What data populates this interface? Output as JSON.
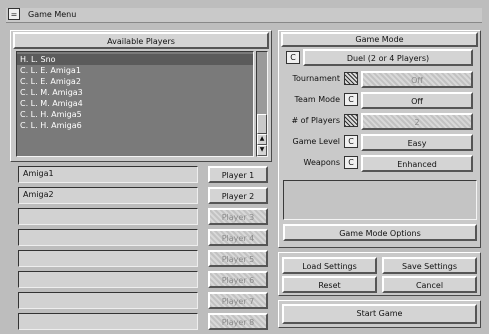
{
  "window": {
    "title": "Game Menu",
    "menu_glyph": "="
  },
  "players": {
    "header": "Available Players",
    "list": [
      "H. L. Sno",
      "C. L. E. Amiga1",
      "C. L. E. Amiga2",
      "C. L. M. Amiga3",
      "C. L. M. Amiga4",
      "C. L. H. Amiga5",
      "C. L. H. Amiga6"
    ],
    "scroll_up": "▲",
    "scroll_down": "▼",
    "slots": [
      {
        "value": "Amiga1",
        "button": "Player 1",
        "enabled": true
      },
      {
        "value": "Amiga2",
        "button": "Player 2",
        "enabled": true
      },
      {
        "value": "",
        "button": "Player 3",
        "enabled": false
      },
      {
        "value": "",
        "button": "Player 4",
        "enabled": false
      },
      {
        "value": "",
        "button": "Player 5",
        "enabled": false
      },
      {
        "value": "",
        "button": "Player 6",
        "enabled": false
      },
      {
        "value": "",
        "button": "Player 7",
        "enabled": false
      },
      {
        "value": "",
        "button": "Player 8",
        "enabled": false
      }
    ]
  },
  "game_mode": {
    "header": "Game Mode",
    "cycle_glyph": "C",
    "mode_value": "Duel (2 or 4 Players)",
    "rows": [
      {
        "label": "Tournament",
        "value": "Off",
        "enabled": false
      },
      {
        "label": "Team Mode",
        "value": "Off",
        "enabled": true
      },
      {
        "label": "# of Players",
        "value": "2",
        "enabled": false
      },
      {
        "label": "Game Level",
        "value": "Easy",
        "enabled": true
      },
      {
        "label": "Weapons",
        "value": "Enhanced",
        "enabled": true
      }
    ],
    "options_button": "Game Mode Options"
  },
  "actions": {
    "load_settings": "Load Settings",
    "save_settings": "Save Settings",
    "reset": "Reset",
    "cancel": "Cancel",
    "start_game": "Start Game"
  }
}
